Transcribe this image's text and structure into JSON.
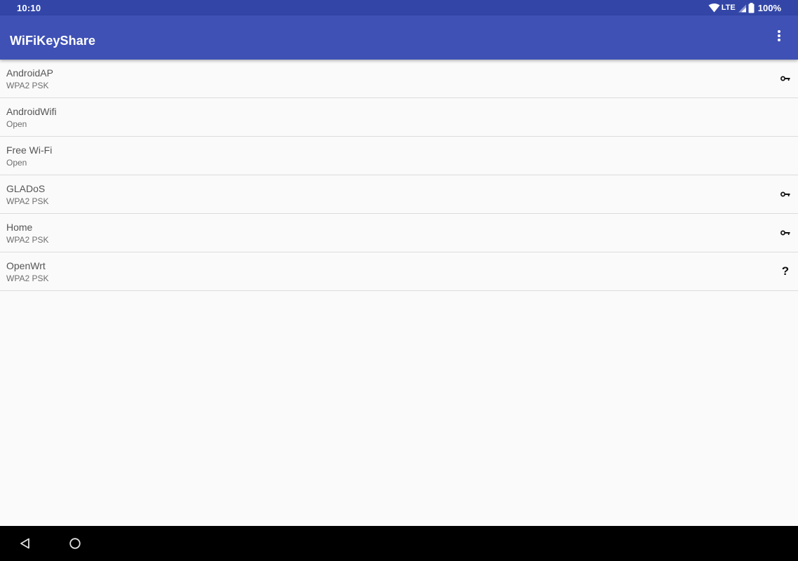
{
  "status_bar": {
    "time": "10:10",
    "network": "LTE",
    "battery": "100%"
  },
  "app_bar": {
    "title": "WiFiKeyShare",
    "menu_icon": "more-vert-icon"
  },
  "networks": [
    {
      "ssid": "AndroidAP",
      "security": "WPA2 PSK",
      "status_icon": "key-icon"
    },
    {
      "ssid": "AndroidWifi",
      "security": "Open",
      "status_icon": ""
    },
    {
      "ssid": "Free Wi-Fi",
      "security": "Open",
      "status_icon": ""
    },
    {
      "ssid": "GLADoS",
      "security": "WPA2 PSK",
      "status_icon": "key-icon"
    },
    {
      "ssid": "Home",
      "security": "WPA2 PSK",
      "status_icon": "key-icon"
    },
    {
      "ssid": "OpenWrt",
      "security": "WPA2 PSK",
      "status_icon": "question-icon",
      "status_text": "?"
    }
  ],
  "nav_bar": {
    "back_icon": "back-triangle-icon",
    "home_icon": "home-circle-icon"
  },
  "colors": {
    "status_bar": "#3346a8",
    "app_bar": "#3f51b5",
    "background": "#fafafa",
    "divider": "#dcdcdc",
    "nav_bar": "#000000"
  }
}
